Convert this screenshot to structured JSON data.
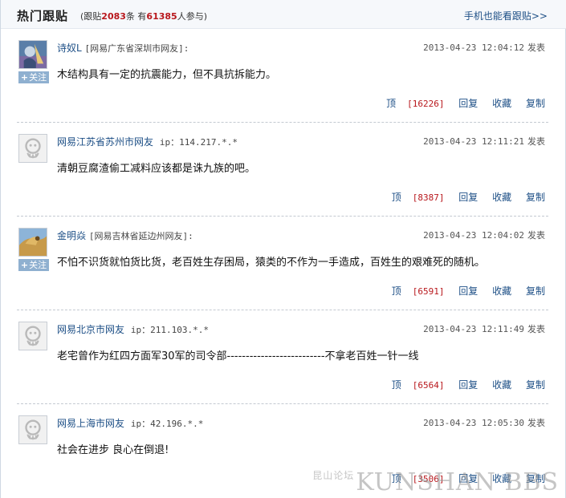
{
  "header": {
    "title": "热门跟贴",
    "stats_prefix": "(跟贴",
    "post_count": "2083",
    "stats_mid": "条  有",
    "participant_count": "61385",
    "stats_suffix": "人参与)",
    "mobile_link": "手机也能看跟贴>>"
  },
  "posts": [
    {
      "name": "诗奴L",
      "location": "[网易广东省深圳市网友]:",
      "ip": "",
      "time": "2013-04-23 12:04:12",
      "publish": "发表",
      "content": "木结构具有一定的抗震能力，但不具抗拆能力。",
      "has_follow": true,
      "follow_label": "关注",
      "top_label": "顶",
      "top_count": "[16226]",
      "reply": "回复",
      "collect": "收藏",
      "copy": "复制"
    },
    {
      "name": "网易江苏省苏州市网友",
      "location": "",
      "ip": "ip：114.217.*.*",
      "time": "2013-04-23 12:11:21",
      "publish": "发表",
      "content": "清朝豆腐渣偷工减料应该都是诛九族的吧。",
      "has_follow": false,
      "follow_label": "",
      "top_label": "顶",
      "top_count": "[8387]",
      "reply": "回复",
      "collect": "收藏",
      "copy": "复制"
    },
    {
      "name": "金明焱",
      "location": "[网易吉林省延边州网友]:",
      "ip": "",
      "time": "2013-04-23 12:04:02",
      "publish": "发表",
      "content": "不怕不识货就怕货比货，老百姓生存困局，猿类的不作为一手造成，百姓生的艰难死的随机。",
      "has_follow": true,
      "follow_label": "关注",
      "top_label": "顶",
      "top_count": "[6591]",
      "reply": "回复",
      "collect": "收藏",
      "copy": "复制"
    },
    {
      "name": "网易北京市网友",
      "location": "",
      "ip": "ip：211.103.*.*",
      "time": "2013-04-23 12:11:49",
      "publish": "发表",
      "content": "老宅曾作为红四方面军30军的司令部--------------------------不拿老百姓一针一线",
      "has_follow": false,
      "follow_label": "",
      "top_label": "顶",
      "top_count": "[6564]",
      "reply": "回复",
      "collect": "收藏",
      "copy": "复制"
    },
    {
      "name": "网易上海市网友",
      "location": "",
      "ip": "ip：42.196.*.*",
      "time": "2013-04-23 12:05:30",
      "publish": "发表",
      "content": "社会在进步   良心在倒退!",
      "has_follow": false,
      "follow_label": "",
      "top_label": "顶",
      "top_count": "[3506]",
      "reply": "回复",
      "collect": "收藏",
      "copy": "复制"
    }
  ],
  "watermark": {
    "small": "昆山论坛",
    "big": "KUNSHAN BBS"
  }
}
